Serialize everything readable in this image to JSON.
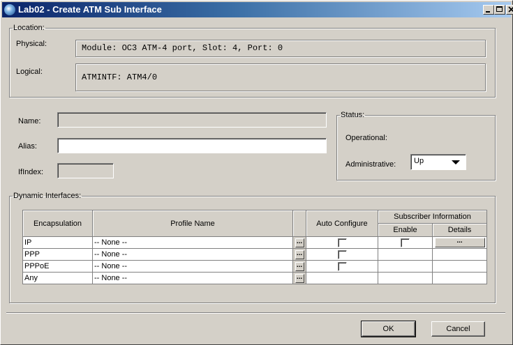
{
  "window": {
    "title": "Lab02 - Create ATM Sub Interface",
    "icon": "app-globe-icon",
    "controls": [
      "minimize-icon",
      "maximize-icon",
      "close-icon"
    ]
  },
  "location": {
    "legend": "Location:",
    "physical_label": "Physical:",
    "physical_value": "Module: OC3 ATM-4 port, Slot: 4, Port: 0",
    "logical_label": "Logical:",
    "logical_value": "ATMINTF: ATM4/0"
  },
  "fields": {
    "name_label": "Name:",
    "name_value": "",
    "alias_label": "Alias:",
    "alias_value": "",
    "ifindex_label": "IfIndex:",
    "ifindex_value": ""
  },
  "status": {
    "legend": "Status:",
    "operational_label": "Operational:",
    "operational_value": "",
    "administrative_label": "Administrative:",
    "administrative_value": "Up"
  },
  "dynamic": {
    "legend": "Dynamic Interfaces:",
    "headers": {
      "encapsulation": "Encapsulation",
      "profile_name": "Profile Name",
      "auto_configure": "Auto Configure",
      "subscriber_information": "Subscriber Information",
      "enable": "Enable",
      "details": "Details"
    },
    "ellipsis": "...",
    "rows": [
      {
        "encapsulation": "IP",
        "profile": "-- None --",
        "auto_configure": false,
        "enable": false,
        "details": true
      },
      {
        "encapsulation": "PPP",
        "profile": "-- None --",
        "auto_configure": false
      },
      {
        "encapsulation": "PPPoE",
        "profile": "-- None --",
        "auto_configure": false
      },
      {
        "encapsulation": "Any",
        "profile": "-- None --"
      }
    ]
  },
  "buttons": {
    "ok": "OK",
    "cancel": "Cancel"
  }
}
